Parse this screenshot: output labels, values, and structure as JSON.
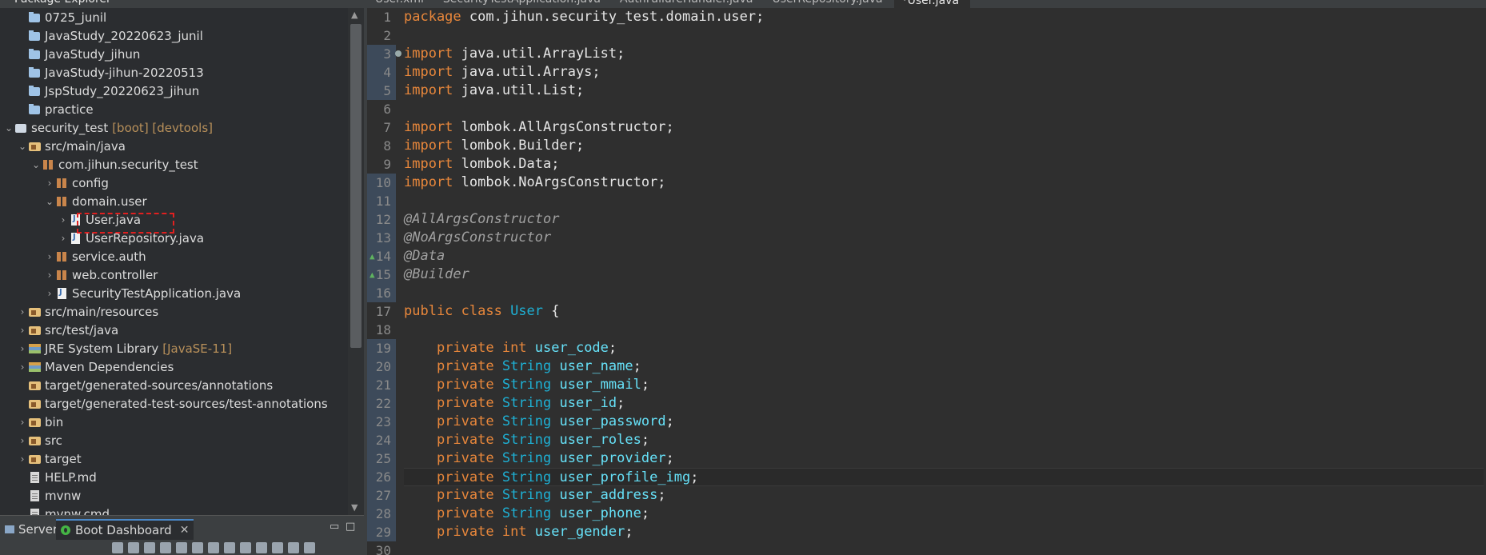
{
  "explorer": {
    "title": "Package Explorer",
    "items": [
      {
        "indent": 1,
        "arrow": "",
        "icon": "folder",
        "label": "0725_junil",
        "decor": ""
      },
      {
        "indent": 1,
        "arrow": "",
        "icon": "folder",
        "label": "JavaStudy_20220623_junil",
        "decor": ""
      },
      {
        "indent": 1,
        "arrow": "",
        "icon": "folder",
        "label": "JavaStudy_jihun",
        "decor": ""
      },
      {
        "indent": 1,
        "arrow": "",
        "icon": "folder",
        "label": "JavaStudy-jihun-20220513",
        "decor": ""
      },
      {
        "indent": 1,
        "arrow": "",
        "icon": "folder",
        "label": "JspStudy_20220623_jihun",
        "decor": ""
      },
      {
        "indent": 1,
        "arrow": "",
        "icon": "folder",
        "label": "practice",
        "decor": ""
      },
      {
        "indent": 0,
        "arrow": "v",
        "icon": "project",
        "label": "security_test",
        "decor": "[boot] [devtools]"
      },
      {
        "indent": 1,
        "arrow": "v",
        "icon": "srcfolder",
        "label": "src/main/java",
        "decor": ""
      },
      {
        "indent": 2,
        "arrow": "v",
        "icon": "package",
        "label": "com.jihun.security_test",
        "decor": ""
      },
      {
        "indent": 3,
        "arrow": ">",
        "icon": "package",
        "label": "config",
        "decor": ""
      },
      {
        "indent": 3,
        "arrow": "v",
        "icon": "package",
        "label": "domain.user",
        "decor": ""
      },
      {
        "indent": 4,
        "arrow": ">",
        "icon": "java",
        "label": "User.java",
        "decor": ""
      },
      {
        "indent": 4,
        "arrow": ">",
        "icon": "java",
        "label": "UserRepository.java",
        "decor": ""
      },
      {
        "indent": 3,
        "arrow": ">",
        "icon": "package",
        "label": "service.auth",
        "decor": ""
      },
      {
        "indent": 3,
        "arrow": ">",
        "icon": "package",
        "label": "web.controller",
        "decor": ""
      },
      {
        "indent": 3,
        "arrow": ">",
        "icon": "java",
        "label": "SecurityTestApplication.java",
        "decor": ""
      },
      {
        "indent": 1,
        "arrow": ">",
        "icon": "srcfolder",
        "label": "src/main/resources",
        "decor": ""
      },
      {
        "indent": 1,
        "arrow": ">",
        "icon": "srcfolder",
        "label": "src/test/java",
        "decor": ""
      },
      {
        "indent": 1,
        "arrow": ">",
        "icon": "lib",
        "label": "JRE System Library",
        "decor": "[JavaSE-11]"
      },
      {
        "indent": 1,
        "arrow": ">",
        "icon": "lib",
        "label": "Maven Dependencies",
        "decor": ""
      },
      {
        "indent": 1,
        "arrow": "",
        "icon": "srcfolder",
        "label": "target/generated-sources/annotations",
        "decor": ""
      },
      {
        "indent": 1,
        "arrow": "",
        "icon": "srcfolder",
        "label": "target/generated-test-sources/test-annotations",
        "decor": ""
      },
      {
        "indent": 1,
        "arrow": ">",
        "icon": "srcfolder",
        "label": "bin",
        "decor": ""
      },
      {
        "indent": 1,
        "arrow": ">",
        "icon": "srcfolder",
        "label": "src",
        "decor": ""
      },
      {
        "indent": 1,
        "arrow": ">",
        "icon": "srcfolder",
        "label": "target",
        "decor": ""
      },
      {
        "indent": 1,
        "arrow": "",
        "icon": "file",
        "label": "HELP.md",
        "decor": ""
      },
      {
        "indent": 1,
        "arrow": "",
        "icon": "file",
        "label": "mvnw",
        "decor": ""
      },
      {
        "indent": 1,
        "arrow": "",
        "icon": "file",
        "label": "mvnw.cmd",
        "decor": ""
      }
    ]
  },
  "bottom_panel": {
    "tabs": [
      {
        "label": "Servers"
      },
      {
        "label": "Boot Dashboard"
      }
    ],
    "close_glyph": "✕",
    "minimize_glyph": "▭",
    "maximize_glyph": "□"
  },
  "editor": {
    "tabs": [
      {
        "label": "User.xml",
        "active": false
      },
      {
        "label": "SecurityTestApplication.java",
        "active": false
      },
      {
        "label": "AuthFailureHandler.java",
        "active": false
      },
      {
        "label": "UserRepository.java",
        "active": false
      },
      {
        "label": "*User.java",
        "active": true
      }
    ],
    "lines": [
      [
        [
          "kw",
          "package"
        ],
        [
          "pun",
          " com.jihun.security_test.domain.user;"
        ]
      ],
      [],
      [
        [
          "kw",
          "import"
        ],
        [
          "pun",
          " java.util.ArrayList;"
        ]
      ],
      [
        [
          "kw",
          "import"
        ],
        [
          "pun",
          " java.util.Arrays;"
        ]
      ],
      [
        [
          "kw",
          "import"
        ],
        [
          "pun",
          " java.util.List;"
        ]
      ],
      [],
      [
        [
          "kw",
          "import"
        ],
        [
          "pun",
          " lombok.AllArgsConstructor;"
        ]
      ],
      [
        [
          "kw",
          "import"
        ],
        [
          "pun",
          " lombok.Builder;"
        ]
      ],
      [
        [
          "kw",
          "import"
        ],
        [
          "pun",
          " lombok.Data;"
        ]
      ],
      [
        [
          "kw",
          "import"
        ],
        [
          "pun",
          " lombok.NoArgsConstructor;"
        ]
      ],
      [],
      [
        [
          "ann",
          "@AllArgsConstructor"
        ]
      ],
      [
        [
          "ann",
          "@NoArgsConstructor"
        ]
      ],
      [
        [
          "ann",
          "@Data"
        ]
      ],
      [
        [
          "ann",
          "@Builder"
        ]
      ],
      [],
      [
        [
          "kw",
          "public class "
        ],
        [
          "type",
          "User"
        ],
        [
          "pun",
          " {"
        ]
      ],
      [],
      [
        [
          "pun",
          "    "
        ],
        [
          "kw",
          "private int "
        ],
        [
          "field",
          "user_code"
        ],
        [
          "pun",
          ";"
        ]
      ],
      [
        [
          "pun",
          "    "
        ],
        [
          "kw",
          "private "
        ],
        [
          "type",
          "String "
        ],
        [
          "field",
          "user_name"
        ],
        [
          "pun",
          ";"
        ]
      ],
      [
        [
          "pun",
          "    "
        ],
        [
          "kw",
          "private "
        ],
        [
          "type",
          "String "
        ],
        [
          "field",
          "user_mmail"
        ],
        [
          "pun",
          ";"
        ]
      ],
      [
        [
          "pun",
          "    "
        ],
        [
          "kw",
          "private "
        ],
        [
          "type",
          "String "
        ],
        [
          "field",
          "user_id"
        ],
        [
          "pun",
          ";"
        ]
      ],
      [
        [
          "pun",
          "    "
        ],
        [
          "kw",
          "private "
        ],
        [
          "type",
          "String "
        ],
        [
          "field",
          "user_password"
        ],
        [
          "pun",
          ";"
        ]
      ],
      [
        [
          "pun",
          "    "
        ],
        [
          "kw",
          "private "
        ],
        [
          "type",
          "String "
        ],
        [
          "field",
          "user_roles"
        ],
        [
          "pun",
          ";"
        ]
      ],
      [
        [
          "pun",
          "    "
        ],
        [
          "kw",
          "private "
        ],
        [
          "type",
          "String "
        ],
        [
          "field",
          "user_provider"
        ],
        [
          "pun",
          ";"
        ]
      ],
      [
        [
          "pun",
          "    "
        ],
        [
          "kw",
          "private "
        ],
        [
          "type",
          "String "
        ],
        [
          "field",
          "user_profile_img"
        ],
        [
          "pun",
          ";"
        ]
      ],
      [
        [
          "pun",
          "    "
        ],
        [
          "kw",
          "private "
        ],
        [
          "type",
          "String "
        ],
        [
          "field",
          "user_address"
        ],
        [
          "pun",
          ";"
        ]
      ],
      [
        [
          "pun",
          "    "
        ],
        [
          "kw",
          "private "
        ],
        [
          "type",
          "String "
        ],
        [
          "field",
          "user_phone"
        ],
        [
          "pun",
          ";"
        ]
      ],
      [
        [
          "pun",
          "    "
        ],
        [
          "kw",
          "private int "
        ],
        [
          "field",
          "user_gender"
        ],
        [
          "pun",
          ";"
        ]
      ],
      []
    ],
    "line_numbers": [
      "1",
      "2",
      "3",
      "4",
      "5",
      "6",
      "7",
      "8",
      "9",
      "10",
      "11",
      "12",
      "13",
      "14",
      "15",
      "16",
      "17",
      "18",
      "19",
      "20",
      "21",
      "22",
      "23",
      "24",
      "25",
      "26",
      "27",
      "28",
      "29",
      "30"
    ],
    "marked_lines": [
      3,
      4,
      5,
      10,
      11,
      12,
      13,
      14,
      15,
      16,
      19,
      20,
      21,
      22,
      23,
      24,
      25,
      26,
      27,
      28,
      29
    ],
    "current_line": 26
  },
  "colors": {
    "keyword": "#e8873b",
    "type": "#1eb0d4",
    "field": "#66e1f8",
    "annotation": "#a0a0a0",
    "highlight": "#e02020"
  }
}
